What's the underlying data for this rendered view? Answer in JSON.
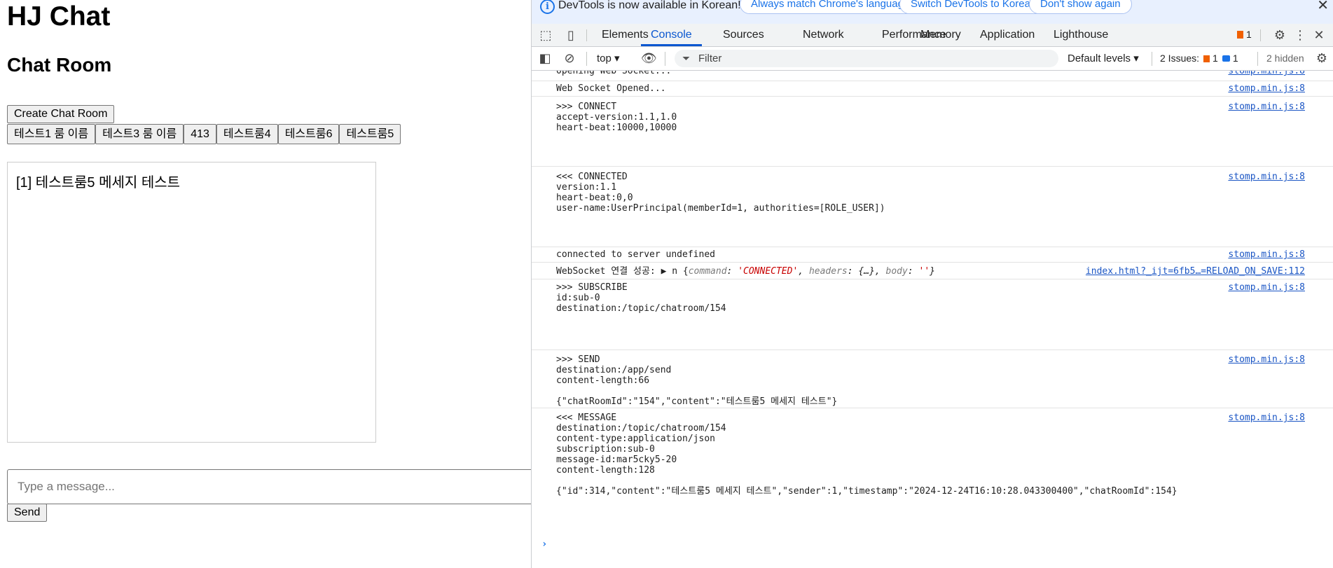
{
  "page": {
    "title": "HJ Chat",
    "subtitle": "Chat Room",
    "create_button": "Create Chat Room",
    "rooms": [
      "테스트1 룸 이름",
      "테스트3 룸 이름",
      "413",
      "테스트룸4",
      "테스트룸6",
      "테스트룸5"
    ],
    "messages": [
      "[1] 테스트룸5 메세지 테스트"
    ],
    "input_placeholder": "Type a message...",
    "send_button": "Send"
  },
  "devtools": {
    "infobar": {
      "text": "DevTools is now available in Korean!",
      "btn_match": "Always match Chrome's language",
      "btn_switch": "Switch DevTools to Korean",
      "btn_dismiss": "Don't show again"
    },
    "tabs": [
      "Elements",
      "Console",
      "Sources",
      "Network",
      "Performance",
      "Memory",
      "Application",
      "Lighthouse"
    ],
    "active_tab": "Console",
    "issues_badge": "1",
    "toolbar": {
      "context": "top",
      "filter_placeholder": "Filter",
      "levels": "Default levels",
      "issues_label": "2 Issues:",
      "issues_warn": "1",
      "issues_info": "1",
      "hidden": "2 hidden"
    },
    "logs": [
      {
        "text": "Opening Web Socket...",
        "source": "stomp.min.js:8"
      },
      {
        "text": "Web Socket Opened...",
        "source": "stomp.min.js:8"
      },
      {
        "text": ">>> CONNECT\naccept-version:1.1,1.0\nheart-beat:10000,10000\n\n\n",
        "source": "stomp.min.js:8"
      },
      {
        "text": "<<< CONNECTED\nversion:1.1\nheart-beat:0,0\nuser-name:UserPrincipal(memberId=1, authorities=[ROLE_USER])\n\n\n",
        "source": "stomp.min.js:8"
      },
      {
        "text": "connected to server undefined",
        "source": "stomp.min.js:8"
      },
      {
        "text": "WebSocket 연결 성공: ",
        "object_parts": [
          "▶ n {",
          "command",
          ": ",
          "'CONNECTED'",
          ", ",
          "headers",
          ": {…}, ",
          "body",
          ": ",
          "''",
          "}"
        ],
        "source": "index.html?_ijt=6fb5…=RELOAD_ON_SAVE:112"
      },
      {
        "text": ">>> SUBSCRIBE\nid:sub-0\ndestination:/topic/chatroom/154\n\n\n",
        "source": "stomp.min.js:8"
      },
      {
        "text": ">>> SEND\ndestination:/app/send\ncontent-length:66\n\n{\"chatRoomId\":\"154\",\"content\":\"테스트룸5 메세지 테스트\"}",
        "source": "stomp.min.js:8"
      },
      {
        "text": "<<< MESSAGE\ndestination:/topic/chatroom/154\ncontent-type:application/json\nsubscription:sub-0\nmessage-id:mar5cky5-20\ncontent-length:128\n\n{\"id\":314,\"content\":\"테스트룸5 메세지 테스트\",\"sender\":1,\"timestamp\":\"2024-12-24T16:10:28.043300400\",\"chatRoomId\":154}",
        "source": "stomp.min.js:8"
      }
    ],
    "prompt": "›"
  }
}
